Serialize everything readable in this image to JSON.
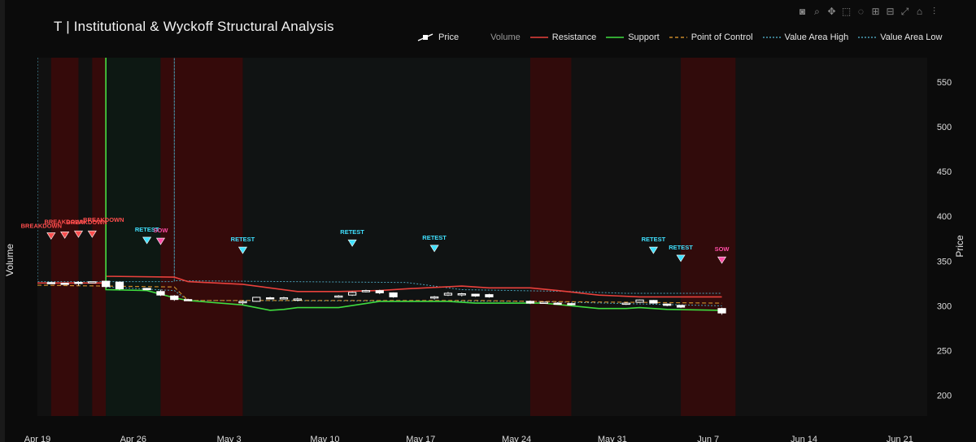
{
  "title": "T | Institutional & Wyckoff Structural Analysis",
  "toolbar": [
    "camera-icon",
    "zoom-icon",
    "pan-icon",
    "box-select-icon",
    "lasso-icon",
    "zoom-in-icon",
    "zoom-out-icon",
    "autoscale-icon",
    "home-icon",
    "plotly-logo-icon"
  ],
  "y_axis_left_label": "Volume",
  "y_axis_right_label": "Price",
  "legend": [
    {
      "name": "Price",
      "color": "#ffffff",
      "style": "candle"
    },
    {
      "name": "Volume",
      "color": "#9a9a9a",
      "style": "none"
    },
    {
      "name": "Resistance",
      "color": "#e8413c",
      "style": "solid"
    },
    {
      "name": "Support",
      "color": "#3fdc3f",
      "style": "solid"
    },
    {
      "name": "Point of Control",
      "color": "#c8882a",
      "style": "dash"
    },
    {
      "name": "Value Area High",
      "color": "#4aa0b8",
      "style": "dot"
    },
    {
      "name": "Value Area Low",
      "color": "#4aa0b8",
      "style": "dot"
    }
  ],
  "chart_data": {
    "type": "candlestick",
    "x_axis": {
      "start": "2021-04-19",
      "end": "2021-06-23",
      "ticks": [
        {
          "date": "2021-04-19",
          "label": "Apr 19"
        },
        {
          "date": "2021-04-26",
          "label": "Apr 26"
        },
        {
          "date": "2021-05-03",
          "label": "May 3"
        },
        {
          "date": "2021-05-10",
          "label": "May 10"
        },
        {
          "date": "2021-05-17",
          "label": "May 17"
        },
        {
          "date": "2021-05-24",
          "label": "May 24"
        },
        {
          "date": "2021-05-31",
          "label": "May 31"
        },
        {
          "date": "2021-06-07",
          "label": "Jun 7"
        },
        {
          "date": "2021-06-14",
          "label": "Jun 14"
        },
        {
          "date": "2021-06-21",
          "label": "Jun 21"
        }
      ]
    },
    "y_axis": {
      "side": "right",
      "range": [
        177,
        577
      ],
      "ticks": [
        200,
        250,
        300,
        350,
        400,
        450,
        500,
        550
      ]
    },
    "grid": false,
    "candles": [
      {
        "date": "2021-04-20",
        "open": 326,
        "high": 326.6,
        "low": 325.5,
        "close": 325.9
      },
      {
        "date": "2021-04-21",
        "open": 325.2,
        "high": 325.5,
        "low": 324.6,
        "close": 324.9
      },
      {
        "date": "2021-04-22",
        "open": 326.2,
        "high": 327.5,
        "low": 322.5,
        "close": 325.4
      },
      {
        "date": "2021-04-23",
        "open": 326.6,
        "high": 327.2,
        "low": 325.9,
        "close": 326.9
      },
      {
        "date": "2021-04-24",
        "open": 327.5,
        "high": 328,
        "low": 320,
        "close": 321.5
      },
      {
        "date": "2021-04-25",
        "open": 326.5,
        "high": 327,
        "low": 317.5,
        "close": 319
      },
      {
        "date": "2021-04-27",
        "open": 319.5,
        "high": 320,
        "low": 317.5,
        "close": 318
      },
      {
        "date": "2021-04-28",
        "open": 316,
        "high": 318,
        "low": 311,
        "close": 312
      },
      {
        "date": "2021-04-29",
        "open": 311,
        "high": 312,
        "low": 305.5,
        "close": 307
      },
      {
        "date": "2021-04-30",
        "open": 307,
        "high": 308,
        "low": 305.5,
        "close": 306.5
      },
      {
        "date": "2021-05-04",
        "open": 304.5,
        "high": 306,
        "low": 301.5,
        "close": 304.7
      },
      {
        "date": "2021-05-05",
        "open": 305,
        "high": 310,
        "low": 304.5,
        "close": 309.5
      },
      {
        "date": "2021-05-06",
        "open": 309,
        "high": 310,
        "low": 307.5,
        "close": 308.5
      },
      {
        "date": "2021-05-07",
        "open": 308,
        "high": 310,
        "low": 307,
        "close": 309
      },
      {
        "date": "2021-05-08",
        "open": 307.5,
        "high": 309,
        "low": 305,
        "close": 307.7
      },
      {
        "date": "2021-05-11",
        "open": 310,
        "high": 312,
        "low": 309,
        "close": 311
      },
      {
        "date": "2021-05-12",
        "open": 312,
        "high": 316,
        "low": 311,
        "close": 315
      },
      {
        "date": "2021-05-13",
        "open": 316,
        "high": 318,
        "low": 315,
        "close": 317
      },
      {
        "date": "2021-05-14",
        "open": 317,
        "high": 318,
        "low": 313,
        "close": 314.5
      },
      {
        "date": "2021-05-15",
        "open": 314.5,
        "high": 315,
        "low": 309,
        "close": 310
      },
      {
        "date": "2021-05-18",
        "open": 309,
        "high": 311,
        "low": 307,
        "close": 310
      },
      {
        "date": "2021-05-19",
        "open": 312,
        "high": 315.5,
        "low": 311,
        "close": 314
      },
      {
        "date": "2021-05-20",
        "open": 312.5,
        "high": 314.5,
        "low": 310.5,
        "close": 313.5
      },
      {
        "date": "2021-05-21",
        "open": 313,
        "high": 313.5,
        "low": 310,
        "close": 311
      },
      {
        "date": "2021-05-22",
        "open": 312.5,
        "high": 313.5,
        "low": 309,
        "close": 310
      },
      {
        "date": "2021-05-25",
        "open": 305,
        "high": 306,
        "low": 302,
        "close": 303
      },
      {
        "date": "2021-05-26",
        "open": 303.5,
        "high": 304.5,
        "low": 302.5,
        "close": 304
      },
      {
        "date": "2021-05-27",
        "open": 303,
        "high": 304,
        "low": 301.5,
        "close": 302
      },
      {
        "date": "2021-05-28",
        "open": 302.5,
        "high": 303,
        "low": 300.5,
        "close": 301.5
      },
      {
        "date": "2021-06-01",
        "open": 302,
        "high": 304,
        "low": 301,
        "close": 303
      },
      {
        "date": "2021-06-02",
        "open": 304,
        "high": 307,
        "low": 303.5,
        "close": 306.5
      },
      {
        "date": "2021-06-03",
        "open": 306,
        "high": 306.5,
        "low": 302.5,
        "close": 303
      },
      {
        "date": "2021-06-04",
        "open": 302,
        "high": 302.5,
        "low": 299.5,
        "close": 300.5
      },
      {
        "date": "2021-06-05",
        "open": 300.5,
        "high": 301,
        "low": 297.5,
        "close": 298.5
      },
      {
        "date": "2021-06-08",
        "open": 297,
        "high": 298,
        "low": 290,
        "close": 292
      }
    ],
    "resistance": [
      {
        "date": "2021-04-19",
        "value": 325.5
      },
      {
        "date": "2021-04-24",
        "value": 325.5
      },
      {
        "date": "2021-04-24",
        "value": 577
      },
      {
        "date": "2021-04-24",
        "value": 333
      },
      {
        "date": "2021-04-29",
        "value": 332
      },
      {
        "date": "2021-04-30",
        "value": 327
      },
      {
        "date": "2021-05-04",
        "value": 324
      },
      {
        "date": "2021-05-08",
        "value": 316
      },
      {
        "date": "2021-05-11",
        "value": 316
      },
      {
        "date": "2021-05-14",
        "value": 317
      },
      {
        "date": "2021-05-16",
        "value": 319
      },
      {
        "date": "2021-05-20",
        "value": 322
      },
      {
        "date": "2021-05-22",
        "value": 320
      },
      {
        "date": "2021-05-25",
        "value": 320
      },
      {
        "date": "2021-05-27",
        "value": 317
      },
      {
        "date": "2021-05-30",
        "value": 312
      },
      {
        "date": "2021-06-02",
        "value": 310
      },
      {
        "date": "2021-06-08",
        "value": 310
      }
    ],
    "support": [
      {
        "date": "2021-04-24",
        "value": 577
      },
      {
        "date": "2021-04-24",
        "value": 318
      },
      {
        "date": "2021-04-27",
        "value": 317
      },
      {
        "date": "2021-04-29",
        "value": 309
      },
      {
        "date": "2021-04-30",
        "value": 306
      },
      {
        "date": "2021-05-04",
        "value": 301
      },
      {
        "date": "2021-05-06",
        "value": 295
      },
      {
        "date": "2021-05-07",
        "value": 296
      },
      {
        "date": "2021-05-08",
        "value": 298
      },
      {
        "date": "2021-05-11",
        "value": 298
      },
      {
        "date": "2021-05-14",
        "value": 305
      },
      {
        "date": "2021-05-19",
        "value": 305
      },
      {
        "date": "2021-05-21",
        "value": 303
      },
      {
        "date": "2021-05-26",
        "value": 303
      },
      {
        "date": "2021-05-30",
        "value": 297
      },
      {
        "date": "2021-06-01",
        "value": 297
      },
      {
        "date": "2021-06-02",
        "value": 298
      },
      {
        "date": "2021-06-04",
        "value": 296
      },
      {
        "date": "2021-06-08",
        "value": 295
      }
    ],
    "point_of_control": [
      {
        "date": "2021-04-19",
        "value": 323
      },
      {
        "date": "2021-04-24",
        "value": 322
      },
      {
        "date": "2021-04-29",
        "value": 321
      },
      {
        "date": "2021-04-30",
        "value": 306
      },
      {
        "date": "2021-05-21",
        "value": 306
      },
      {
        "date": "2021-05-25",
        "value": 305
      },
      {
        "date": "2021-06-08",
        "value": 303
      }
    ],
    "value_area_high": [
      {
        "date": "2021-04-19",
        "value": 577
      },
      {
        "date": "2021-04-19",
        "value": 327
      },
      {
        "date": "2021-04-29",
        "value": 327
      },
      {
        "date": "2021-04-29",
        "value": 577
      },
      {
        "date": "2021-04-29",
        "value": 328
      },
      {
        "date": "2021-05-16",
        "value": 326
      },
      {
        "date": "2021-05-20",
        "value": 318
      },
      {
        "date": "2021-05-28",
        "value": 316
      },
      {
        "date": "2021-06-01",
        "value": 314
      },
      {
        "date": "2021-06-08",
        "value": 314
      }
    ],
    "value_area_low": [
      {
        "date": "2021-04-24",
        "value": 321
      },
      {
        "date": "2021-04-29",
        "value": 317
      },
      {
        "date": "2021-04-30",
        "value": 306
      },
      {
        "date": "2021-05-25",
        "value": 305
      },
      {
        "date": "2021-06-08",
        "value": 300
      }
    ],
    "shaded_regions": [
      {
        "from": "2021-04-20",
        "to": "2021-04-22",
        "color": "#3a0a0a",
        "opacity": 0.9
      },
      {
        "from": "2021-04-23",
        "to": "2021-04-24",
        "color": "#3a0a0a",
        "opacity": 0.9
      },
      {
        "from": "2021-04-24",
        "to": "2021-04-28",
        "color": "#0d1a14",
        "opacity": 0.9
      },
      {
        "from": "2021-04-28",
        "to": "2021-05-04",
        "color": "#3a0a0a",
        "opacity": 0.9
      },
      {
        "from": "2021-05-04",
        "to": "2021-05-25",
        "color": "#101414",
        "opacity": 0.7
      },
      {
        "from": "2021-05-25",
        "to": "2021-05-28",
        "color": "#3a0a0a",
        "opacity": 0.8
      },
      {
        "from": "2021-06-05",
        "to": "2021-06-09",
        "color": "#3a0a0a",
        "opacity": 0.8
      }
    ],
    "annotations": [
      {
        "date": "2021-04-20",
        "value": 378,
        "label": "BREAKDOWN",
        "color": "#ff4d4d",
        "label_offset": [
          -12,
          -10
        ]
      },
      {
        "date": "2021-04-21",
        "value": 379,
        "label": "BREAKDOWN",
        "color": "#ff4d4d",
        "label_offset": [
          0,
          -14
        ]
      },
      {
        "date": "2021-04-22",
        "value": 380,
        "label": "BREAKDOWN",
        "color": "#ff4d4d",
        "label_offset": [
          10,
          -12
        ]
      },
      {
        "date": "2021-04-23",
        "value": 380,
        "label": "BREAKDOWN",
        "color": "#ff4d4d",
        "label_offset": [
          14,
          -15
        ]
      },
      {
        "date": "2021-04-27",
        "value": 373,
        "label": "RETEST",
        "color": "#40e0ff",
        "label_offset": [
          0,
          -11
        ]
      },
      {
        "date": "2021-04-28",
        "value": 372,
        "label": "SOW",
        "color": "#ff4da6",
        "label_offset": [
          0,
          -11
        ]
      },
      {
        "date": "2021-05-04",
        "value": 362,
        "label": "RETEST",
        "color": "#40e0ff",
        "label_offset": [
          0,
          -11
        ]
      },
      {
        "date": "2021-05-12",
        "value": 370,
        "label": "RETEST",
        "color": "#40e0ff",
        "label_offset": [
          0,
          -11
        ]
      },
      {
        "date": "2021-05-18",
        "value": 364,
        "label": "RETEST",
        "color": "#40e0ff",
        "label_offset": [
          0,
          -11
        ]
      },
      {
        "date": "2021-06-03",
        "value": 362,
        "label": "RETEST",
        "color": "#40e0ff",
        "label_offset": [
          0,
          -11
        ]
      },
      {
        "date": "2021-06-05",
        "value": 353,
        "label": "RETEST",
        "color": "#40e0ff",
        "label_offset": [
          0,
          -11
        ]
      },
      {
        "date": "2021-06-08",
        "value": 351,
        "label": "SOW",
        "color": "#ff4da6",
        "label_offset": [
          0,
          -11
        ]
      }
    ]
  }
}
